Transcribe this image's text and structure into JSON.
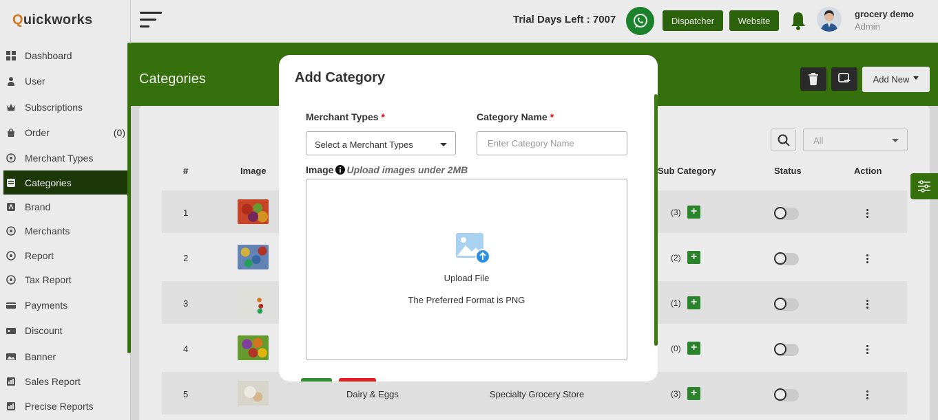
{
  "brand": {
    "first_letter": "Q",
    "rest": "uickworks"
  },
  "sidebar": {
    "items": [
      {
        "label": "Dashboard",
        "icon": "dashboard-icon",
        "count": ""
      },
      {
        "label": "User",
        "icon": "user-icon",
        "count": ""
      },
      {
        "label": "Subscriptions",
        "icon": "crown-icon",
        "count": ""
      },
      {
        "label": "Order",
        "icon": "bag-icon",
        "count": "(0)"
      },
      {
        "label": "Merchant Types",
        "icon": "merchant-types-icon",
        "count": ""
      },
      {
        "label": "Categories",
        "icon": "categories-icon",
        "count": ""
      },
      {
        "label": "Brand",
        "icon": "brand-icon",
        "count": ""
      },
      {
        "label": "Merchants",
        "icon": "merchants-icon",
        "count": ""
      },
      {
        "label": "Report",
        "icon": "report-icon",
        "count": ""
      },
      {
        "label": "Tax Report",
        "icon": "tax-report-icon",
        "count": ""
      },
      {
        "label": "Payments",
        "icon": "payments-icon",
        "count": ""
      },
      {
        "label": "Discount",
        "icon": "discount-icon",
        "count": ""
      },
      {
        "label": "Banner",
        "icon": "banner-icon",
        "count": ""
      },
      {
        "label": "Sales Report",
        "icon": "sales-report-icon",
        "count": ""
      },
      {
        "label": "Precise Reports",
        "icon": "precise-reports-icon",
        "count": ""
      }
    ],
    "active_index": 5
  },
  "topbar": {
    "trial": "Trial Days Left : 7007",
    "dispatcher_label": "Dispatcher",
    "website_label": "Website",
    "user_name": "grocery demo",
    "user_role": "Admin"
  },
  "page": {
    "title": "Categories",
    "add_new_label": "Add New",
    "filter_value": "All"
  },
  "table": {
    "headers": {
      "num": "#",
      "image": "Image",
      "sub_category": "Sub Category",
      "status": "Status",
      "action": "Action"
    },
    "rows": [
      {
        "num": "1",
        "name": "",
        "merchant_type": "",
        "sub_count": "(3)"
      },
      {
        "num": "2",
        "name": "",
        "merchant_type": "",
        "sub_count": "(2)"
      },
      {
        "num": "3",
        "name": "",
        "merchant_type": "",
        "sub_count": "(1)"
      },
      {
        "num": "4",
        "name": "",
        "merchant_type": "",
        "sub_count": "(0)"
      },
      {
        "num": "5",
        "name": "Dairy & Eggs",
        "merchant_type": "Specialty Grocery Store",
        "sub_count": "(3)"
      }
    ]
  },
  "modal": {
    "title": "Add Category",
    "merchant_types_label": "Merchant Types",
    "merchant_types_value": "Select a Merchant Types",
    "category_name_label": "Category Name",
    "category_name_placeholder": "Enter Category Name",
    "required_mark": "*",
    "image_label": "Image",
    "image_hint": "Upload images under 2MB",
    "upload_title": "Upload File",
    "upload_sub": "The Preferred Format is PNG"
  },
  "colors": {
    "brand_green": "#3b7a0e",
    "dark_green": "#1f3d0a",
    "danger": "#e02020",
    "accent_orange": "#e8821e"
  }
}
